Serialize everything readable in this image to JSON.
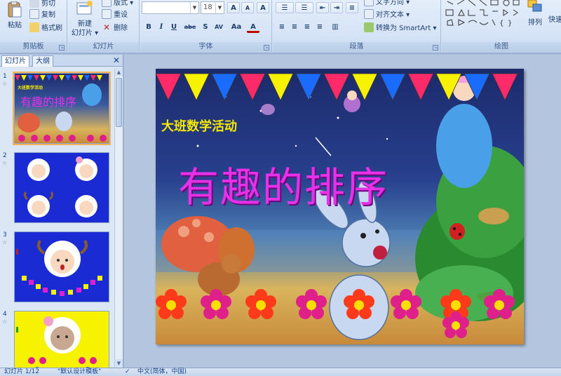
{
  "ribbon": {
    "clipboard": {
      "group_label": "剪贴板",
      "paste": "粘贴",
      "cut": "剪切",
      "copy": "复制",
      "format_painter": "格式刷"
    },
    "slides": {
      "group_label": "幻灯片",
      "new_slide_line1": "新建",
      "new_slide_line2": "幻灯片 ▾",
      "layout": "版式 ▾",
      "reset": "重设",
      "delete": "删除"
    },
    "font": {
      "group_label": "字体",
      "font_name": "",
      "font_size": "18",
      "bold": "B",
      "italic": "I",
      "underline": "U",
      "strike": "abe",
      "shadow": "S",
      "spacing": "AV",
      "case": "Aa",
      "grow": "A",
      "shrink": "A",
      "clear": "A"
    },
    "paragraph": {
      "group_label": "段落",
      "text_direction": "文字方向 ▾",
      "align_text": "对齐文本 ▾",
      "smartart": "转换为 SmartArt ▾"
    },
    "drawing": {
      "group_label": "绘图",
      "arrange": "排列",
      "quick_styles": "快速"
    }
  },
  "left_panel": {
    "tab_slides": "幻灯片",
    "tab_outline": "大纲",
    "close": "✕",
    "thumbnails": [
      {
        "number": "1",
        "title": "有趣的排序",
        "subtitle": "大班数学活动"
      },
      {
        "number": "2"
      },
      {
        "number": "3"
      },
      {
        "number": "4"
      }
    ]
  },
  "slide": {
    "title": "有趣的排序",
    "subtitle": "大班数学活动"
  },
  "status": {
    "slide_info": "幻灯片 1/12",
    "theme": "\"默认设计模板\"",
    "language": "中文(简体，中国)"
  },
  "colors": {
    "ribbon_bg": "#d5e3f6",
    "title_magenta": "#e830e8",
    "subtitle_yellow": "#f4e800",
    "thumb_blue_bg": "#1a2bd4",
    "thumb_yellow_bg": "#f7f200"
  }
}
